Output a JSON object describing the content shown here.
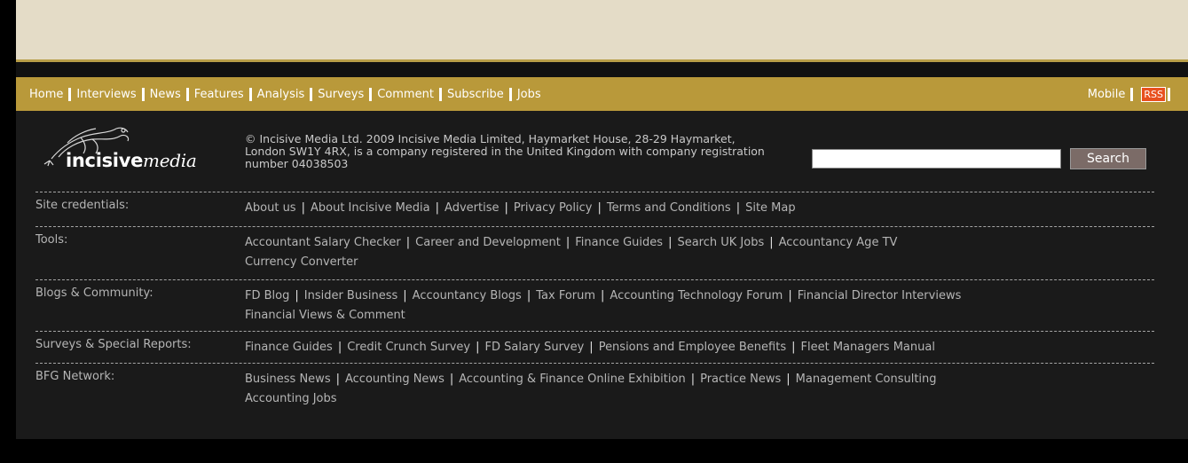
{
  "nav": {
    "left": [
      {
        "label": "Home"
      },
      {
        "label": "Interviews"
      },
      {
        "label": "News"
      },
      {
        "label": "Features"
      },
      {
        "label": "Analysis"
      },
      {
        "label": "Surveys"
      },
      {
        "label": "Comment"
      },
      {
        "label": "Subscribe"
      },
      {
        "label": "Jobs"
      }
    ],
    "mobile": "Mobile",
    "rss": "RSS"
  },
  "logo": {
    "bold": "incisive",
    "italic": "media"
  },
  "copyright": "© Incisive Media Ltd. 2009 Incisive Media Limited, Haymarket House, 28-29 Haymarket, London SW1Y 4RX, is a company registered in the United Kingdom with company registration number 04038503",
  "search": {
    "button": "Search",
    "value": ""
  },
  "sections": [
    {
      "label": "Site credentials:",
      "lines": [
        [
          "About us",
          "About Incisive Media",
          "Advertise",
          "Privacy Policy",
          "Terms and Conditions",
          "Site Map"
        ]
      ]
    },
    {
      "label": "Tools:",
      "lines": [
        [
          "Accountant Salary Checker",
          "Career and Development",
          "Finance Guides",
          "Search UK Jobs",
          "Accountancy Age TV"
        ],
        [
          "Currency Converter"
        ]
      ]
    },
    {
      "label": "Blogs & Community:",
      "lines": [
        [
          "FD Blog",
          "Insider Business",
          "Accountancy Blogs",
          "Tax Forum",
          "Accounting Technology Forum",
          "Financial Director Interviews"
        ],
        [
          "Financial Views & Comment"
        ]
      ]
    },
    {
      "label": "Surveys & Special Reports:",
      "lines": [
        [
          "Finance Guides",
          "Credit Crunch Survey",
          "FD Salary Survey",
          "Pensions and Employee Benefits",
          "Fleet Managers Manual"
        ]
      ]
    },
    {
      "label": "BFG Network:",
      "lines": [
        [
          "Business News",
          "Accounting News",
          "Accounting & Finance Online Exhibition",
          "Practice News",
          "Management Consulting"
        ],
        [
          "Accounting Jobs"
        ]
      ]
    }
  ],
  "colors": {
    "banner": "#e4dcc7",
    "nav": "#b9993a",
    "footer": "#1a1a1a",
    "rss": "#e8501f"
  }
}
